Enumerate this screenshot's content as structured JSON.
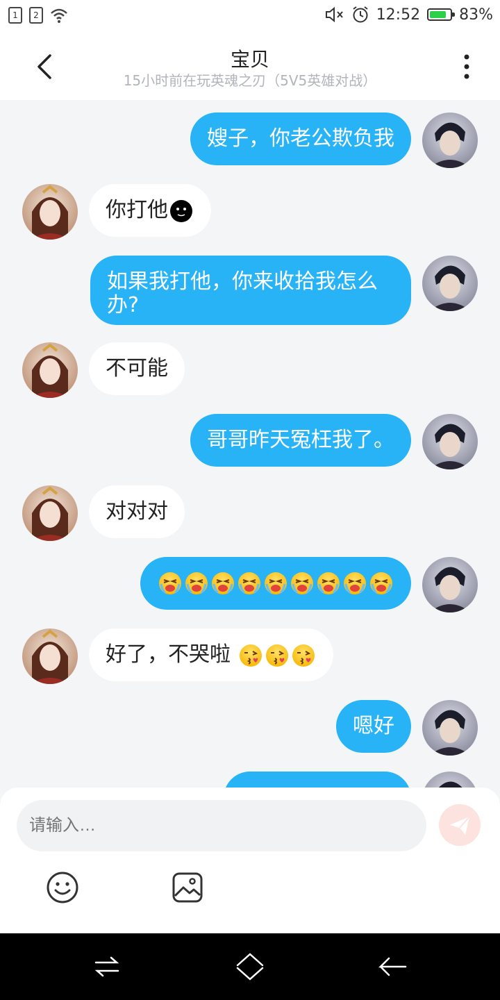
{
  "status_bar": {
    "sim1": "1",
    "sim2": "2",
    "time": "12:52",
    "battery_percent": "83%",
    "battery_level": 0.83,
    "battery_color": "#2bd149"
  },
  "header": {
    "title": "宝贝",
    "subtitle": "15小时前在玩英魂之刃（5V5英雄对战）"
  },
  "messages": [
    {
      "from": "me",
      "text": "嫂子，你老公欺负我"
    },
    {
      "from": "her",
      "text": "你打他",
      "emoji": "dark-face-emoji"
    },
    {
      "from": "me",
      "text": "如果我打他，你来收拾我怎么办?"
    },
    {
      "from": "her",
      "text": "不可能"
    },
    {
      "from": "me",
      "text": "哥哥昨天冤枉我了。"
    },
    {
      "from": "her",
      "text": "对对对"
    },
    {
      "from": "me",
      "text": "",
      "emoji": "crying-emoji",
      "emoji_count": 9
    },
    {
      "from": "her",
      "text": "好了，不哭啦",
      "emoji": "kissing-emoji",
      "emoji_count": 3
    },
    {
      "from": "me",
      "text": "嗯好"
    }
  ],
  "composer": {
    "placeholder": "请输入…",
    "send_icon": "send-icon",
    "tools": [
      "emoji-icon",
      "image-icon"
    ]
  },
  "colors": {
    "my_bubble": "#27b3f6",
    "her_bubble": "#ffffff",
    "chat_background": "#f4f5f7"
  }
}
